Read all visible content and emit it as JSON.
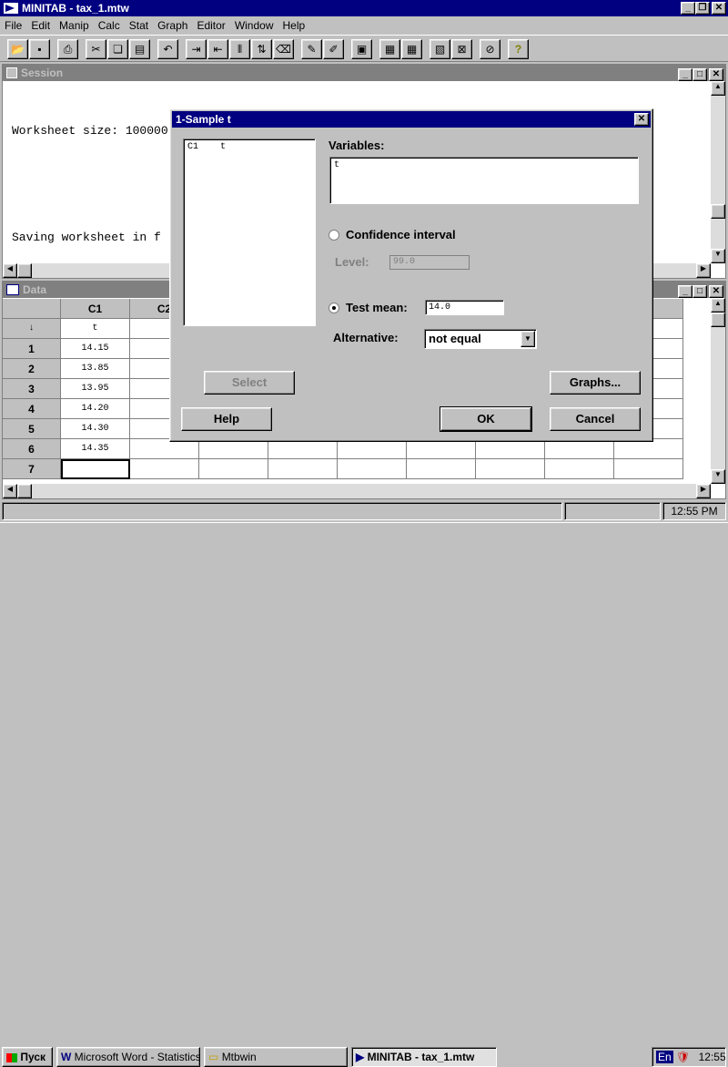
{
  "app": {
    "title": "MINITAB - tax_1.mtw"
  },
  "menu": [
    "File",
    "Edit",
    "Manip",
    "Calc",
    "Stat",
    "Graph",
    "Editor",
    "Window",
    "Help"
  ],
  "session": {
    "title": "Session",
    "lines": [
      "Worksheet size: 100000 cells",
      "",
      "Saving worksheet in f"
    ]
  },
  "data": {
    "title": "Data",
    "columns": [
      "",
      "C1",
      "C2",
      "",
      "",
      "",
      "",
      "",
      "",
      "C"
    ],
    "names": [
      "↓",
      "t"
    ],
    "rows": [
      [
        "1",
        "14.15"
      ],
      [
        "2",
        "13.85"
      ],
      [
        "3",
        "13.95"
      ],
      [
        "4",
        "14.20"
      ],
      [
        "5",
        "14.30"
      ],
      [
        "6",
        "14.35"
      ],
      [
        "7",
        ""
      ]
    ]
  },
  "dialog": {
    "title": "1-Sample t",
    "list": {
      "col": "C1",
      "name": "t"
    },
    "variables_label": "Variables:",
    "variables_value": "t",
    "ci_label": "Confidence interval",
    "level_label": "Level:",
    "level_value": "99.0",
    "tm_label": "Test mean:",
    "tm_value": "14.0",
    "alt_label": "Alternative:",
    "alt_value": "not equal",
    "select": "Select",
    "graphs": "Graphs...",
    "help": "Help",
    "ok": "OK",
    "cancel": "Cancel"
  },
  "status": {
    "time": "12:55 PM"
  },
  "taskbar": {
    "start": "Пуск",
    "items": [
      "Microsoft Word - Statistics...",
      "Mtbwin",
      "MINITAB - tax_1.mtw"
    ],
    "lang": "En",
    "clock": "12:55"
  }
}
